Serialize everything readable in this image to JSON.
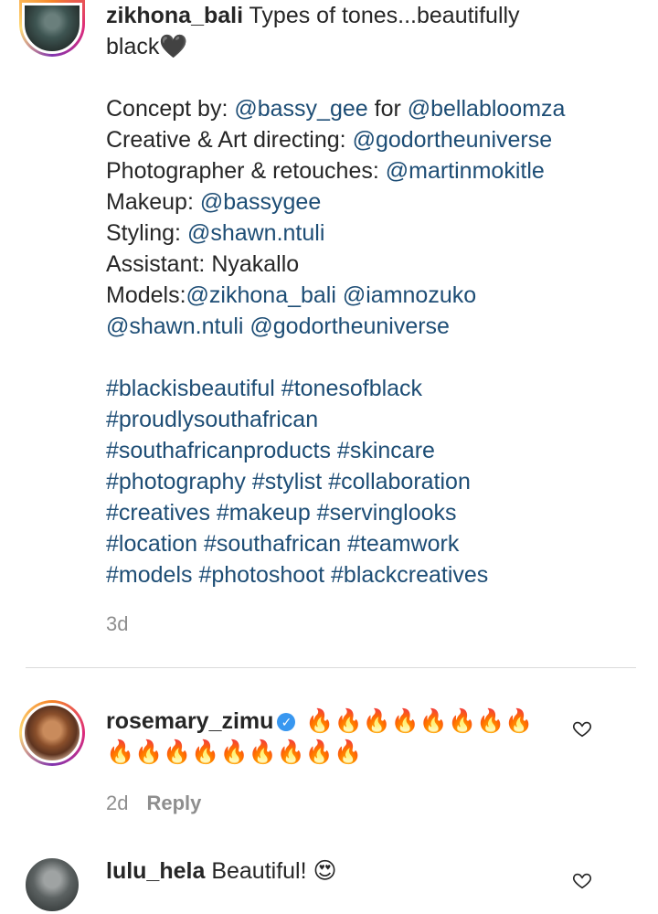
{
  "post": {
    "username": "zikhona_bali",
    "caption_line1": " Types of tones...beautifully",
    "caption_line2": "black",
    "caption_line2_emoji": "🖤",
    "credits": {
      "concept_label": "Concept by: ",
      "concept_mention": "@bassy_gee",
      "concept_for": " for ",
      "concept_brand": "@bellabloomza",
      "creative_label": "Creative & Art directing: ",
      "creative_mention": "@godortheuniverse",
      "photo_label": "Photographer & retouches: ",
      "photo_mention": "@martinmokitle",
      "makeup_label": "Makeup: ",
      "makeup_mention": "@bassygee",
      "styling_label": "Styling: ",
      "styling_mention": "@shawn.ntuli",
      "assistant_text": "Assistant: Nyakallo",
      "models_label": "Models:",
      "models_line1_mentions": "@zikhona_bali @iamnozuko",
      "models_line2_mentions": "@shawn.ntuli @godortheuniverse"
    },
    "hashtags": [
      "#blackisbeautiful #tonesofblack",
      "#proudlysouthafrican",
      "#southafricanproducts #skincare",
      "#photography #stylist #collaboration",
      "#creatives #makeup #servinglooks",
      "#location #southafrican #teamwork",
      "#models #photoshoot #blackcreatives"
    ],
    "time": "3d"
  },
  "comments": [
    {
      "username": "rosemary_zimu",
      "verified_icon": "✓",
      "text_line1": "🔥🔥🔥🔥🔥🔥🔥🔥",
      "text_line2": "🔥🔥🔥🔥🔥🔥🔥🔥🔥",
      "time": "2d",
      "reply_label": "Reply"
    },
    {
      "username": "lulu_hela",
      "text": " Beautiful! ",
      "emoji": "😍"
    }
  ],
  "icons": {
    "heart": "heart-outline-icon",
    "verified": "verified-badge-icon"
  },
  "colors": {
    "mention": "#1d4d75",
    "muted": "#8e8e8e",
    "verified": "#3897f0"
  }
}
